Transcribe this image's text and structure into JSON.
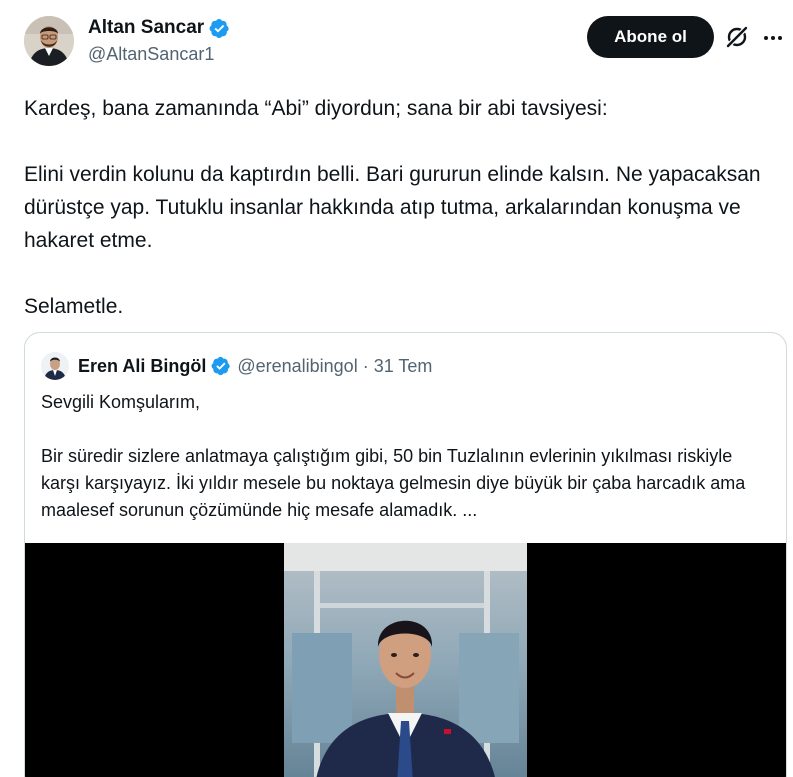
{
  "author": {
    "display_name": "Altan Sancar",
    "handle": "@AltanSancar1",
    "verified": true
  },
  "actions": {
    "follow_label": "Abone ol",
    "grok_icon": "grok-slash-icon",
    "more_icon": "more-dots-icon"
  },
  "tweet": {
    "paragraphs": [
      "Kardeş, bana zamanında “Abi” diyordun; sana bir abi tavsiyesi:",
      "Elini verdin kolunu da kaptırdın belli. Bari gururun elinde kalsın. Ne yapacaksan dürüstçe yap. Tutuklu insanlar hakkında atıp tutma, arkalarından konuşma ve hakaret etme.",
      "Selametle."
    ]
  },
  "quoted": {
    "display_name": "Eren Ali Bingöl",
    "handle": "@erenalibingol",
    "separator": "·",
    "date": "31 Tem",
    "verified": true,
    "paragraphs": [
      "Sevgili Komşularım,",
      "Bir süredir sizlere anlatmaya çalıştığım gibi, 50 bin Tuzlalının evlerinin yıkılması riskiyle karşı karşıyayız. İki yıldır mesele bu noktaya gelmesin diye büyük bir çaba harcadık ama maalesef sorunun çözümünde hiç mesafe alamadık. ..."
    ]
  },
  "colors": {
    "text_primary": "#0f1419",
    "text_secondary": "#536471",
    "verified_blue": "#1d9bf0",
    "border": "#cfd9de",
    "button_bg": "#0f1419"
  }
}
